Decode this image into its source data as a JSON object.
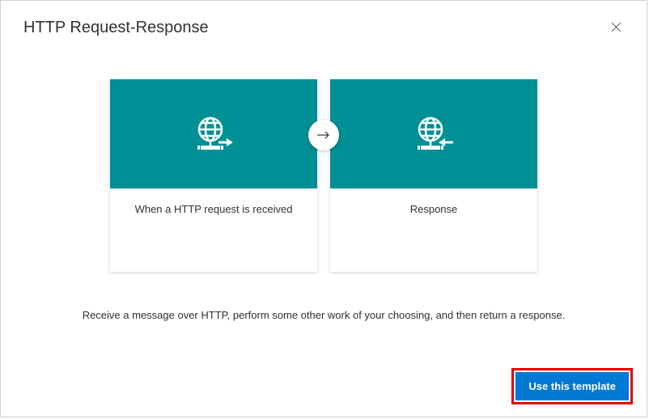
{
  "dialog": {
    "title": "HTTP Request-Response",
    "close_icon": "close"
  },
  "cards": {
    "request": {
      "label": "When a HTTP request is received"
    },
    "response": {
      "label": "Response"
    }
  },
  "description": "Receive a message over HTTP, perform some other work of your choosing, and then return a response.",
  "actions": {
    "use_template": "Use this template"
  },
  "colors": {
    "accent_teal": "#008f95",
    "primary_blue": "#0078d4",
    "highlight_red": "#e60000"
  }
}
